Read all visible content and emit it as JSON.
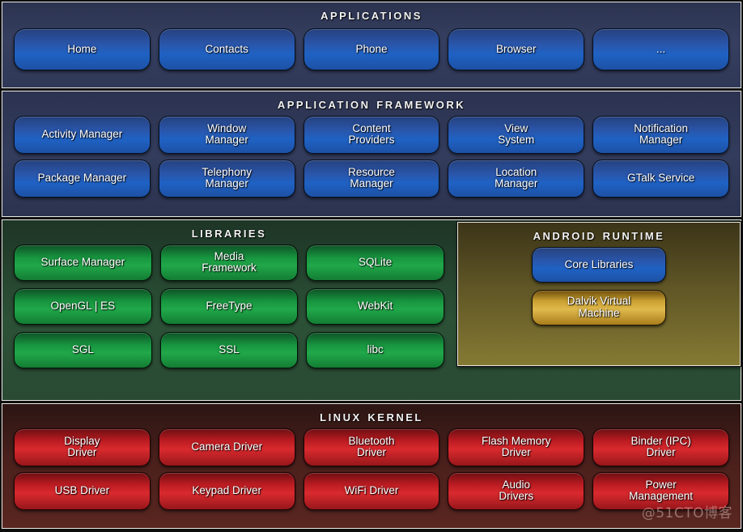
{
  "layers": {
    "applications": {
      "title": "Applications",
      "color": "#2f3857",
      "box_color": "#1f62c4",
      "rows": [
        [
          {
            "label": "Home"
          },
          {
            "label": "Contacts"
          },
          {
            "label": "Phone"
          },
          {
            "label": "Browser"
          },
          {
            "label": "..."
          }
        ]
      ]
    },
    "framework": {
      "title": "Application Framework",
      "color": "#333c5c",
      "box_color": "#1f62c4",
      "rows": [
        [
          {
            "label": "Activity Manager"
          },
          {
            "label": "Window\nManager"
          },
          {
            "label": "Content\nProviders"
          },
          {
            "label": "View\nSystem"
          },
          {
            "label": "Notification\nManager"
          }
        ],
        [
          {
            "label": "Package Manager"
          },
          {
            "label": "Telephony\nManager"
          },
          {
            "label": "Resource\nManager"
          },
          {
            "label": "Location\nManager"
          },
          {
            "label": "GTalk Service"
          }
        ]
      ]
    },
    "libraries": {
      "title": "Libraries",
      "color": "#2c5137",
      "box_color": "#21a84a",
      "rows": [
        [
          {
            "label": "Surface Manager"
          },
          {
            "label": "Media\nFramework"
          },
          {
            "label": "SQLite"
          }
        ],
        [
          {
            "label": "OpenGL | ES"
          },
          {
            "label": "FreeType"
          },
          {
            "label": "WebKit"
          }
        ],
        [
          {
            "label": "SGL"
          },
          {
            "label": "SSL"
          },
          {
            "label": "libc"
          }
        ]
      ]
    },
    "runtime": {
      "title": "Android Runtime",
      "color": "#857a33",
      "boxes": [
        {
          "label": "Core Libraries",
          "box_color": "#1f62c4"
        },
        {
          "label": "Dalvik Virtual\nMachine",
          "box_color": "#e0b94c"
        }
      ]
    },
    "kernel": {
      "title": "Linux Kernel",
      "color": "#5a2620",
      "box_color": "#d92a2e",
      "rows": [
        [
          {
            "label": "Display\nDriver"
          },
          {
            "label": "Camera Driver"
          },
          {
            "label": "Bluetooth\nDriver"
          },
          {
            "label": "Flash Memory\nDriver"
          },
          {
            "label": "Binder (IPC)\nDriver"
          }
        ],
        [
          {
            "label": "USB Driver"
          },
          {
            "label": "Keypad Driver"
          },
          {
            "label": "WiFi Driver"
          },
          {
            "label": "Audio\nDrivers"
          },
          {
            "label": "Power\nManagement"
          }
        ]
      ]
    }
  },
  "watermark": "@51CTO博客"
}
